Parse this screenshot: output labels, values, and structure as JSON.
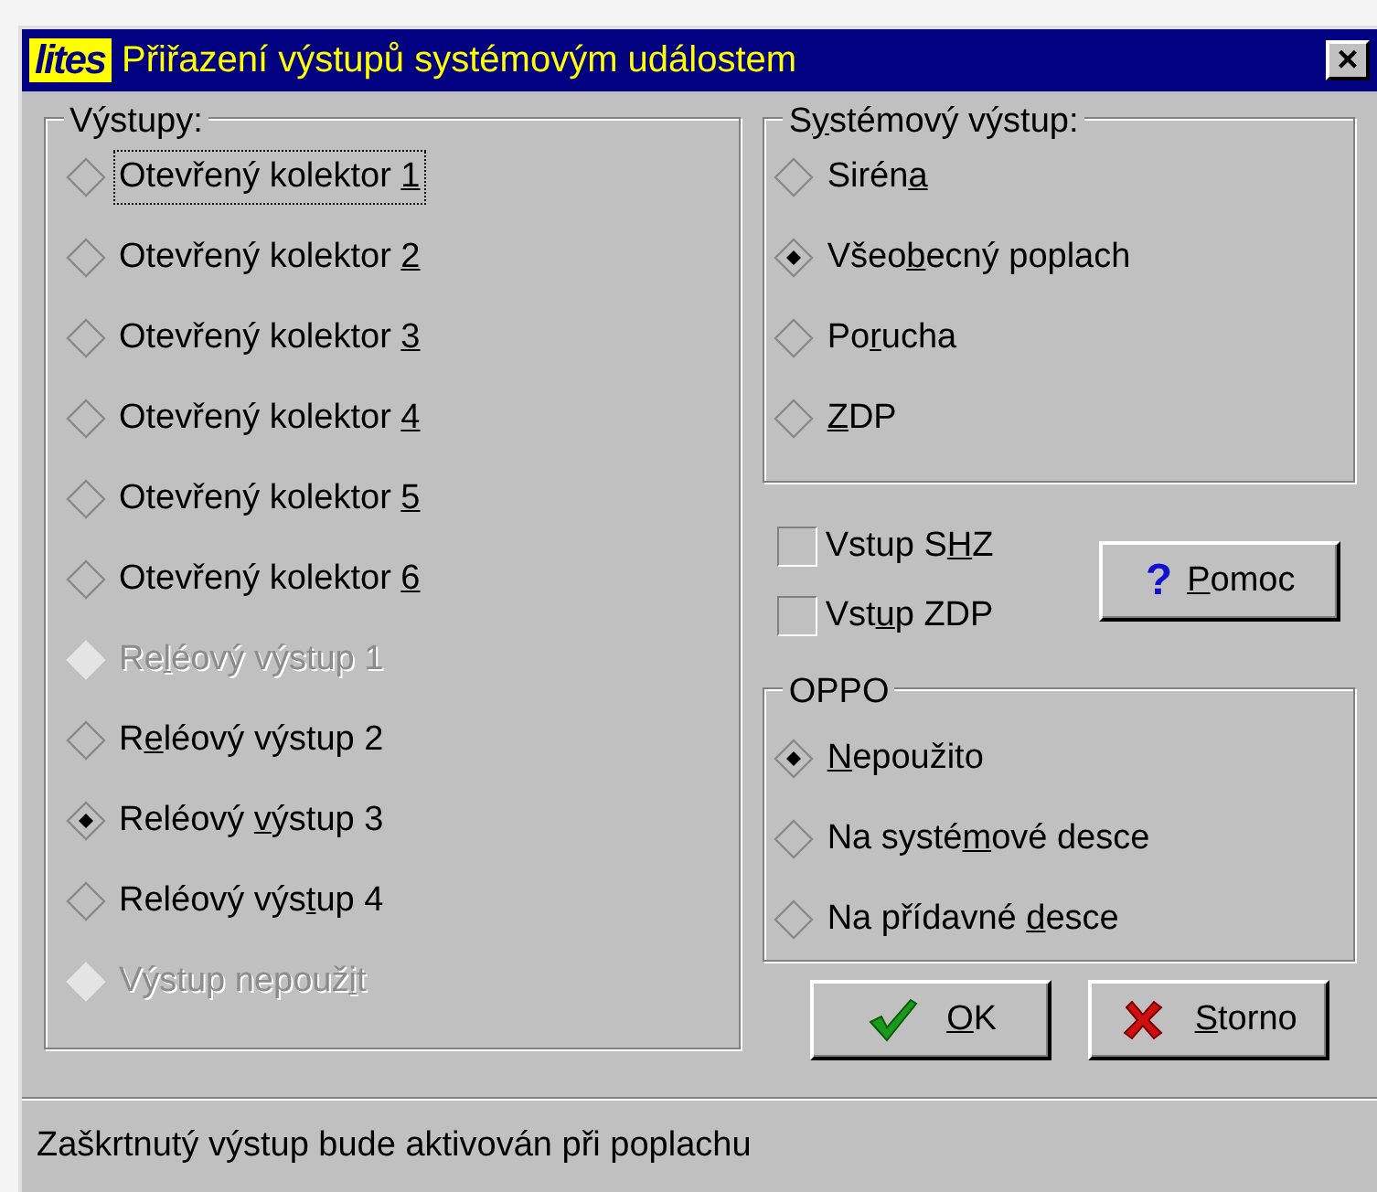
{
  "window": {
    "logo": "lites",
    "title": "Přiřazení výstupů systémovým událostem",
    "close": "×"
  },
  "outputs": {
    "legend": "Výstupy:",
    "items": [
      {
        "before": "Otevřený kolektor ",
        "key": "1",
        "selected": false,
        "disabled": false,
        "focused": true
      },
      {
        "before": "Otevřený kolektor ",
        "key": "2",
        "selected": false,
        "disabled": false,
        "focused": false
      },
      {
        "before": "Otevřený kolektor ",
        "key": "3",
        "selected": false,
        "disabled": false,
        "focused": false
      },
      {
        "before": "Otevřený kolektor ",
        "key": "4",
        "selected": false,
        "disabled": false,
        "focused": false
      },
      {
        "before": "Otevřený kolektor ",
        "key": "5",
        "selected": false,
        "disabled": false,
        "focused": false
      },
      {
        "before": "Otevřený kolektor ",
        "key": "6",
        "selected": false,
        "disabled": false,
        "focused": false
      },
      {
        "before": "Re",
        "key": "l",
        "after": "éový výstup 1",
        "selected": false,
        "disabled": true,
        "focused": false
      },
      {
        "before": "R",
        "key": "e",
        "after": "léový výstup 2",
        "selected": false,
        "disabled": false,
        "focused": false
      },
      {
        "before": "Reléový ",
        "key": "v",
        "after": "ýstup 3",
        "selected": true,
        "disabled": false,
        "focused": false
      },
      {
        "before": "Reléový výs",
        "key": "t",
        "after": "up 4",
        "selected": false,
        "disabled": false,
        "focused": false
      },
      {
        "before": "Výstup nepouž",
        "key": "i",
        "after": "t",
        "selected": false,
        "disabled": true,
        "focused": false
      }
    ]
  },
  "system_output": {
    "legend_before": "S",
    "legend_key": "y",
    "legend_after": "stémový výstup:",
    "items": [
      {
        "before": "Sirén",
        "key": "a",
        "selected": false,
        "disabled": false,
        "focused": false
      },
      {
        "before": "Všeo",
        "key": "b",
        "after": "ecný poplach",
        "selected": true,
        "disabled": false,
        "focused": false
      },
      {
        "before": "Po",
        "key": "r",
        "after": "ucha",
        "selected": false,
        "disabled": false,
        "focused": false
      },
      {
        "key": "Z",
        "after": "DP",
        "selected": false,
        "disabled": false,
        "focused": false
      }
    ]
  },
  "checkboxes": [
    {
      "before": "Vstup S",
      "key": "H",
      "after": "Z",
      "checked": false
    },
    {
      "before": "Vst",
      "key": "u",
      "after": "p ZDP",
      "checked": false
    }
  ],
  "help_button": {
    "icon": "?",
    "key": "P",
    "after": "omoc"
  },
  "oppo": {
    "legend": "OPPO",
    "items": [
      {
        "key": "N",
        "after": "epoužito",
        "selected": true,
        "disabled": false,
        "focused": false
      },
      {
        "before": "Na systé",
        "key": "m",
        "after": "ové desce",
        "selected": false,
        "disabled": false,
        "focused": false
      },
      {
        "before": "Na přídavné ",
        "key": "d",
        "after": "esce",
        "selected": false,
        "disabled": false,
        "focused": false
      }
    ]
  },
  "buttons": [
    {
      "kind": "ok",
      "key": "O",
      "after": "K"
    },
    {
      "kind": "cancel",
      "key": "S",
      "after": "torno"
    }
  ],
  "status_bar": "Zaškrtnutý výstup bude aktivován při poplachu"
}
